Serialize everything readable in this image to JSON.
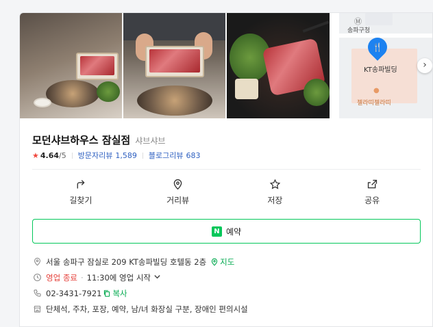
{
  "place": {
    "name": "모던샤브하우스 잠실점",
    "category": "샤브샤브",
    "rating": "4.64",
    "rating_max": "/5",
    "visitor_reviews_label": "방문자리뷰",
    "visitor_reviews_count": "1,589",
    "blog_reviews_label": "블로그리뷰",
    "blog_reviews_count": "683"
  },
  "map": {
    "labels": [
      "송파구청",
      "KT송파빌딩",
      "젤라띠젤라띠"
    ]
  },
  "actions": [
    {
      "label": "길찾기",
      "icon": "directions-icon"
    },
    {
      "label": "거리뷰",
      "icon": "location-pin-icon"
    },
    {
      "label": "저장",
      "icon": "star-icon"
    },
    {
      "label": "공유",
      "icon": "share-icon"
    }
  ],
  "reserve": {
    "badge": "N",
    "label": "예약"
  },
  "info": {
    "address": "서울 송파구 잠실로 209 KT송파빌딩 호텔동 2층",
    "map_link": "지도",
    "status": "영업 종료",
    "hours_note": "11:30에 영업 시작",
    "phone": "02-3431-7921",
    "copy_label": "복사",
    "amenities": "단체석, 주차, 포장, 예약, 남/녀 화장실 구분, 장애인 편의시설"
  },
  "colors": {
    "accent_green": "#03c75a",
    "link_blue": "#2d5fc0",
    "status_red": "#e5403a",
    "star_red": "#f0483e"
  }
}
